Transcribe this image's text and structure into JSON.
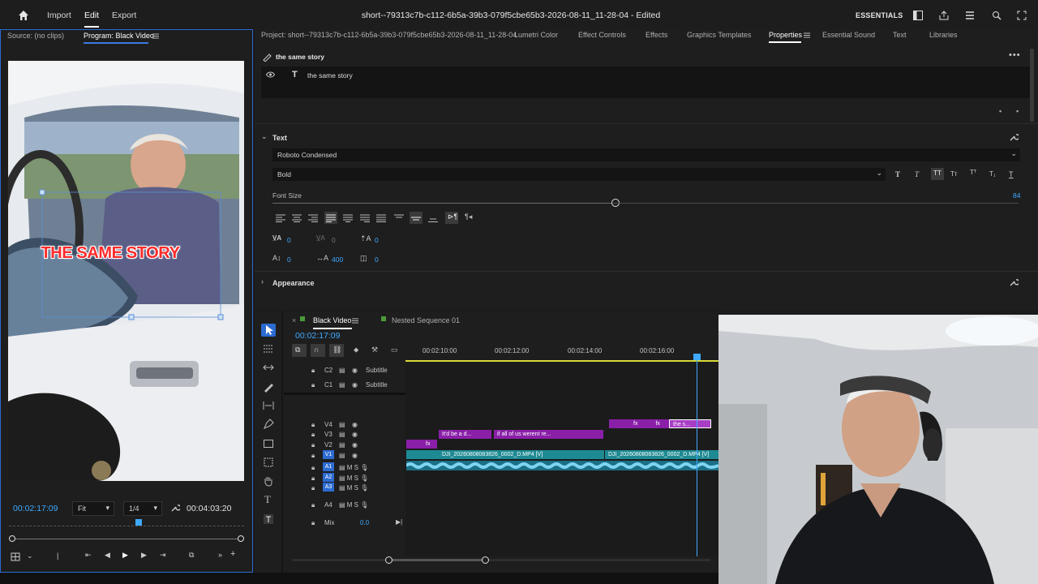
{
  "topbar": {
    "nav": [
      "Import",
      "Edit",
      "Export"
    ],
    "title": "short--79313c7b-c112-6b5a-39b3-079f5cbe65b3-2026-08-11_11-28-04 - Edited",
    "workspace": "ESSENTIALS"
  },
  "source_monitor": {
    "source_tab": "Source: (no clips)",
    "program_tab": "Program: Black Video",
    "caption": "THE SAME STORY",
    "current_tc": "00:02:17:09",
    "fit": "Fit",
    "resolution": "1/4",
    "duration_tc": "00:04:03:20"
  },
  "properties": {
    "project_label": "Project: short--79313c7b-c112-6b5a-39b3-079f5cbe65b3-2026-08-11_11-28-04",
    "tabs": [
      "Lumetri Color",
      "Effect Controls",
      "Effects",
      "Graphics Templates",
      "Properties",
      "Essential Sound",
      "Text",
      "Libraries"
    ],
    "active_tab": "Properties",
    "layer_title": "the same story",
    "layer_item": "the same story",
    "text_section": "Text",
    "font": "Roboto Condensed",
    "style": "Bold",
    "font_size_label": "Font Size",
    "font_size": "84",
    "font_size_level": 0.46,
    "kerning": "0",
    "tracking_dim": "0",
    "baseline": "0",
    "leading": "0",
    "tracking": "400",
    "tsume": "0",
    "appearance_section": "Appearance"
  },
  "timeline": {
    "tabs": [
      "Black Video",
      "Nested Sequence 01"
    ],
    "timecode": "00:02:17:09",
    "ruler": [
      "00:02:10:00",
      "00:02:12:00",
      "00:02:14:00",
      "00:02:16:00"
    ],
    "subtitle_tracks": [
      {
        "id": "C2",
        "label": "Subtitle"
      },
      {
        "id": "C1",
        "label": "Subtitle"
      }
    ],
    "video_tracks": [
      "V4",
      "V3",
      "V2",
      "V1"
    ],
    "audio_tracks": [
      "A1",
      "A2",
      "A3",
      "A4"
    ],
    "mix_label": "Mix",
    "mix_value": "0.0",
    "clips": {
      "v3_a": "It'd be a d...",
      "v3_b": "if all of us werent re...",
      "v4_a": "the s...",
      "v1_a": "DJI_20260808083826_0002_D.MP4 [V]",
      "v1_b": "DJI_20260808083826_0002_D.MP4 [V]",
      "fx": "fx"
    }
  },
  "colors": {
    "accent_blue": "#2c6bd1",
    "timecode_blue": "#3fa9ff",
    "clip_purple": "#8a1fa8",
    "clip_teal": "#1e8a93",
    "caption_red": "#ff2a2a"
  },
  "icons": [
    "home-icon",
    "workspace-icon",
    "share-icon",
    "menu-icon",
    "zoom-icon",
    "expand-icon",
    "eye-icon",
    "text-tool-icon",
    "wrench-icon",
    "chevron-down-icon",
    "play-icon",
    "selection-tool-icon",
    "razor-icon",
    "pen-icon",
    "hand-icon",
    "type-icon"
  ]
}
